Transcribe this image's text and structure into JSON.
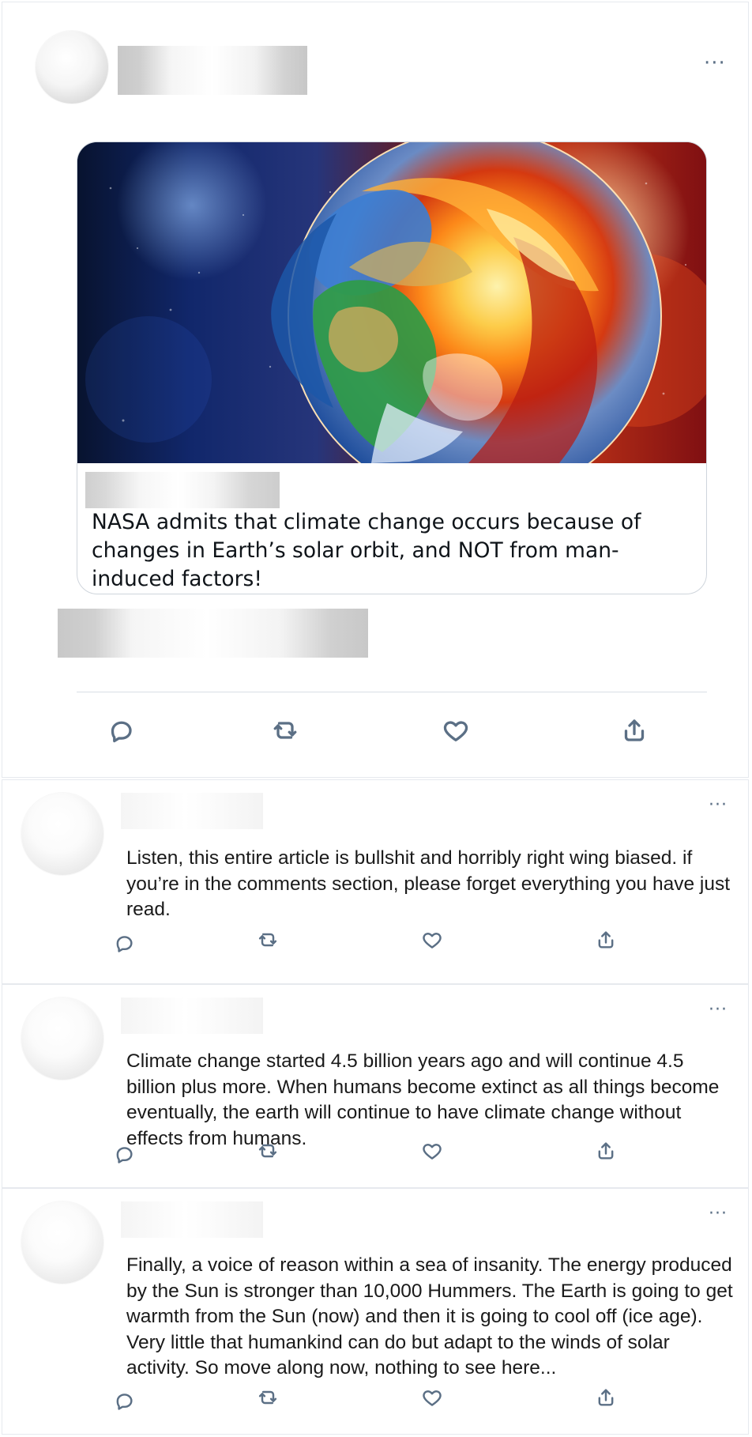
{
  "main_post": {
    "more_label": "···",
    "card": {
      "title": "NASA admits that climate change occurs because of changes in Earth’s solar orbit, and NOT from man-induced factors!"
    }
  },
  "replies": [
    {
      "more_label": "···",
      "text": "Listen, this entire article is bullshit and horribly right wing biased. if you’re in the comments section, please forget everything you have just read."
    },
    {
      "more_label": "···",
      "text": "Climate change started 4.5 billion years ago and will continue 4.5 billion plus more. When humans become extinct as all things become eventually, the earth will continue to have climate change without effects from humans."
    },
    {
      "more_label": "···",
      "text": "Finally, a voice of reason within a sea of insanity. The energy produced by the Sun is stronger than 10,000 Hummers. The Earth is going to get warmth from the Sun (now) and then it is going to cool off (ice age). Very little that humankind can do but adapt to the winds of solar activity. So move along now, nothing to see here..."
    }
  ],
  "icons": {
    "reply": "reply-icon",
    "retweet": "retweet-icon",
    "like": "like-icon",
    "share": "share-icon",
    "more": "more-icon"
  },
  "colors": {
    "icon": "#5b6f85",
    "border": "#e6e9ee",
    "text": "#0f1419"
  }
}
